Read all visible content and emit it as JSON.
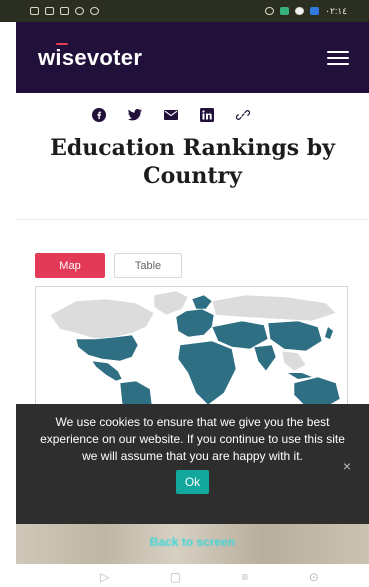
{
  "statusbar": {
    "time": "٠٢:١٤"
  },
  "header": {
    "logo": "wisevoter",
    "menu_icon": "hamburger-menu-icon"
  },
  "share": [
    {
      "name": "facebook-icon"
    },
    {
      "name": "twitter-icon"
    },
    {
      "name": "email-icon"
    },
    {
      "name": "linkedin-icon"
    },
    {
      "name": "link-icon"
    }
  ],
  "page": {
    "title_line1": "Education Rankings by",
    "title_line2": "Country"
  },
  "tabs": {
    "map": "Map",
    "table": "Table"
  },
  "cookie": {
    "message": "We use cookies to ensure that we give you the best experience on our website. If you continue to use this site we will assume that you are happy with it.",
    "ok": "Ok",
    "close": "×"
  },
  "bottom": {
    "back_to_screen": "Back to screen"
  },
  "navbar": {
    "back": "▷",
    "home": "▢",
    "recents": "≡",
    "assistant": "⊙"
  },
  "colors": {
    "header": "#20103a",
    "accent": "#e23a57",
    "map_fill": "#2f6f84",
    "ok_button": "#13a89e"
  }
}
